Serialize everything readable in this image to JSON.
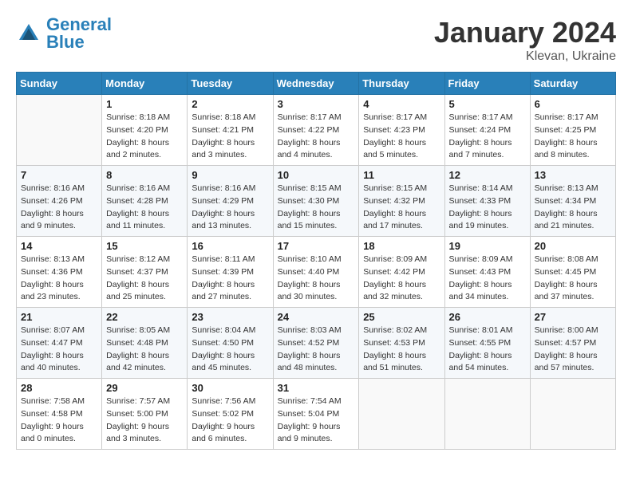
{
  "header": {
    "logo_general": "General",
    "logo_blue": "Blue",
    "title": "January 2024",
    "location": "Klevan, Ukraine"
  },
  "weekdays": [
    "Sunday",
    "Monday",
    "Tuesday",
    "Wednesday",
    "Thursday",
    "Friday",
    "Saturday"
  ],
  "weeks": [
    [
      {
        "day": "",
        "sunrise": "",
        "sunset": "",
        "daylight": ""
      },
      {
        "day": "1",
        "sunrise": "Sunrise: 8:18 AM",
        "sunset": "Sunset: 4:20 PM",
        "daylight": "Daylight: 8 hours and 2 minutes."
      },
      {
        "day": "2",
        "sunrise": "Sunrise: 8:18 AM",
        "sunset": "Sunset: 4:21 PM",
        "daylight": "Daylight: 8 hours and 3 minutes."
      },
      {
        "day": "3",
        "sunrise": "Sunrise: 8:17 AM",
        "sunset": "Sunset: 4:22 PM",
        "daylight": "Daylight: 8 hours and 4 minutes."
      },
      {
        "day": "4",
        "sunrise": "Sunrise: 8:17 AM",
        "sunset": "Sunset: 4:23 PM",
        "daylight": "Daylight: 8 hours and 5 minutes."
      },
      {
        "day": "5",
        "sunrise": "Sunrise: 8:17 AM",
        "sunset": "Sunset: 4:24 PM",
        "daylight": "Daylight: 8 hours and 7 minutes."
      },
      {
        "day": "6",
        "sunrise": "Sunrise: 8:17 AM",
        "sunset": "Sunset: 4:25 PM",
        "daylight": "Daylight: 8 hours and 8 minutes."
      }
    ],
    [
      {
        "day": "7",
        "sunrise": "Sunrise: 8:16 AM",
        "sunset": "Sunset: 4:26 PM",
        "daylight": "Daylight: 8 hours and 9 minutes."
      },
      {
        "day": "8",
        "sunrise": "Sunrise: 8:16 AM",
        "sunset": "Sunset: 4:28 PM",
        "daylight": "Daylight: 8 hours and 11 minutes."
      },
      {
        "day": "9",
        "sunrise": "Sunrise: 8:16 AM",
        "sunset": "Sunset: 4:29 PM",
        "daylight": "Daylight: 8 hours and 13 minutes."
      },
      {
        "day": "10",
        "sunrise": "Sunrise: 8:15 AM",
        "sunset": "Sunset: 4:30 PM",
        "daylight": "Daylight: 8 hours and 15 minutes."
      },
      {
        "day": "11",
        "sunrise": "Sunrise: 8:15 AM",
        "sunset": "Sunset: 4:32 PM",
        "daylight": "Daylight: 8 hours and 17 minutes."
      },
      {
        "day": "12",
        "sunrise": "Sunrise: 8:14 AM",
        "sunset": "Sunset: 4:33 PM",
        "daylight": "Daylight: 8 hours and 19 minutes."
      },
      {
        "day": "13",
        "sunrise": "Sunrise: 8:13 AM",
        "sunset": "Sunset: 4:34 PM",
        "daylight": "Daylight: 8 hours and 21 minutes."
      }
    ],
    [
      {
        "day": "14",
        "sunrise": "Sunrise: 8:13 AM",
        "sunset": "Sunset: 4:36 PM",
        "daylight": "Daylight: 8 hours and 23 minutes."
      },
      {
        "day": "15",
        "sunrise": "Sunrise: 8:12 AM",
        "sunset": "Sunset: 4:37 PM",
        "daylight": "Daylight: 8 hours and 25 minutes."
      },
      {
        "day": "16",
        "sunrise": "Sunrise: 8:11 AM",
        "sunset": "Sunset: 4:39 PM",
        "daylight": "Daylight: 8 hours and 27 minutes."
      },
      {
        "day": "17",
        "sunrise": "Sunrise: 8:10 AM",
        "sunset": "Sunset: 4:40 PM",
        "daylight": "Daylight: 8 hours and 30 minutes."
      },
      {
        "day": "18",
        "sunrise": "Sunrise: 8:09 AM",
        "sunset": "Sunset: 4:42 PM",
        "daylight": "Daylight: 8 hours and 32 minutes."
      },
      {
        "day": "19",
        "sunrise": "Sunrise: 8:09 AM",
        "sunset": "Sunset: 4:43 PM",
        "daylight": "Daylight: 8 hours and 34 minutes."
      },
      {
        "day": "20",
        "sunrise": "Sunrise: 8:08 AM",
        "sunset": "Sunset: 4:45 PM",
        "daylight": "Daylight: 8 hours and 37 minutes."
      }
    ],
    [
      {
        "day": "21",
        "sunrise": "Sunrise: 8:07 AM",
        "sunset": "Sunset: 4:47 PM",
        "daylight": "Daylight: 8 hours and 40 minutes."
      },
      {
        "day": "22",
        "sunrise": "Sunrise: 8:05 AM",
        "sunset": "Sunset: 4:48 PM",
        "daylight": "Daylight: 8 hours and 42 minutes."
      },
      {
        "day": "23",
        "sunrise": "Sunrise: 8:04 AM",
        "sunset": "Sunset: 4:50 PM",
        "daylight": "Daylight: 8 hours and 45 minutes."
      },
      {
        "day": "24",
        "sunrise": "Sunrise: 8:03 AM",
        "sunset": "Sunset: 4:52 PM",
        "daylight": "Daylight: 8 hours and 48 minutes."
      },
      {
        "day": "25",
        "sunrise": "Sunrise: 8:02 AM",
        "sunset": "Sunset: 4:53 PM",
        "daylight": "Daylight: 8 hours and 51 minutes."
      },
      {
        "day": "26",
        "sunrise": "Sunrise: 8:01 AM",
        "sunset": "Sunset: 4:55 PM",
        "daylight": "Daylight: 8 hours and 54 minutes."
      },
      {
        "day": "27",
        "sunrise": "Sunrise: 8:00 AM",
        "sunset": "Sunset: 4:57 PM",
        "daylight": "Daylight: 8 hours and 57 minutes."
      }
    ],
    [
      {
        "day": "28",
        "sunrise": "Sunrise: 7:58 AM",
        "sunset": "Sunset: 4:58 PM",
        "daylight": "Daylight: 9 hours and 0 minutes."
      },
      {
        "day": "29",
        "sunrise": "Sunrise: 7:57 AM",
        "sunset": "Sunset: 5:00 PM",
        "daylight": "Daylight: 9 hours and 3 minutes."
      },
      {
        "day": "30",
        "sunrise": "Sunrise: 7:56 AM",
        "sunset": "Sunset: 5:02 PM",
        "daylight": "Daylight: 9 hours and 6 minutes."
      },
      {
        "day": "31",
        "sunrise": "Sunrise: 7:54 AM",
        "sunset": "Sunset: 5:04 PM",
        "daylight": "Daylight: 9 hours and 9 minutes."
      },
      {
        "day": "",
        "sunrise": "",
        "sunset": "",
        "daylight": ""
      },
      {
        "day": "",
        "sunrise": "",
        "sunset": "",
        "daylight": ""
      },
      {
        "day": "",
        "sunrise": "",
        "sunset": "",
        "daylight": ""
      }
    ]
  ]
}
